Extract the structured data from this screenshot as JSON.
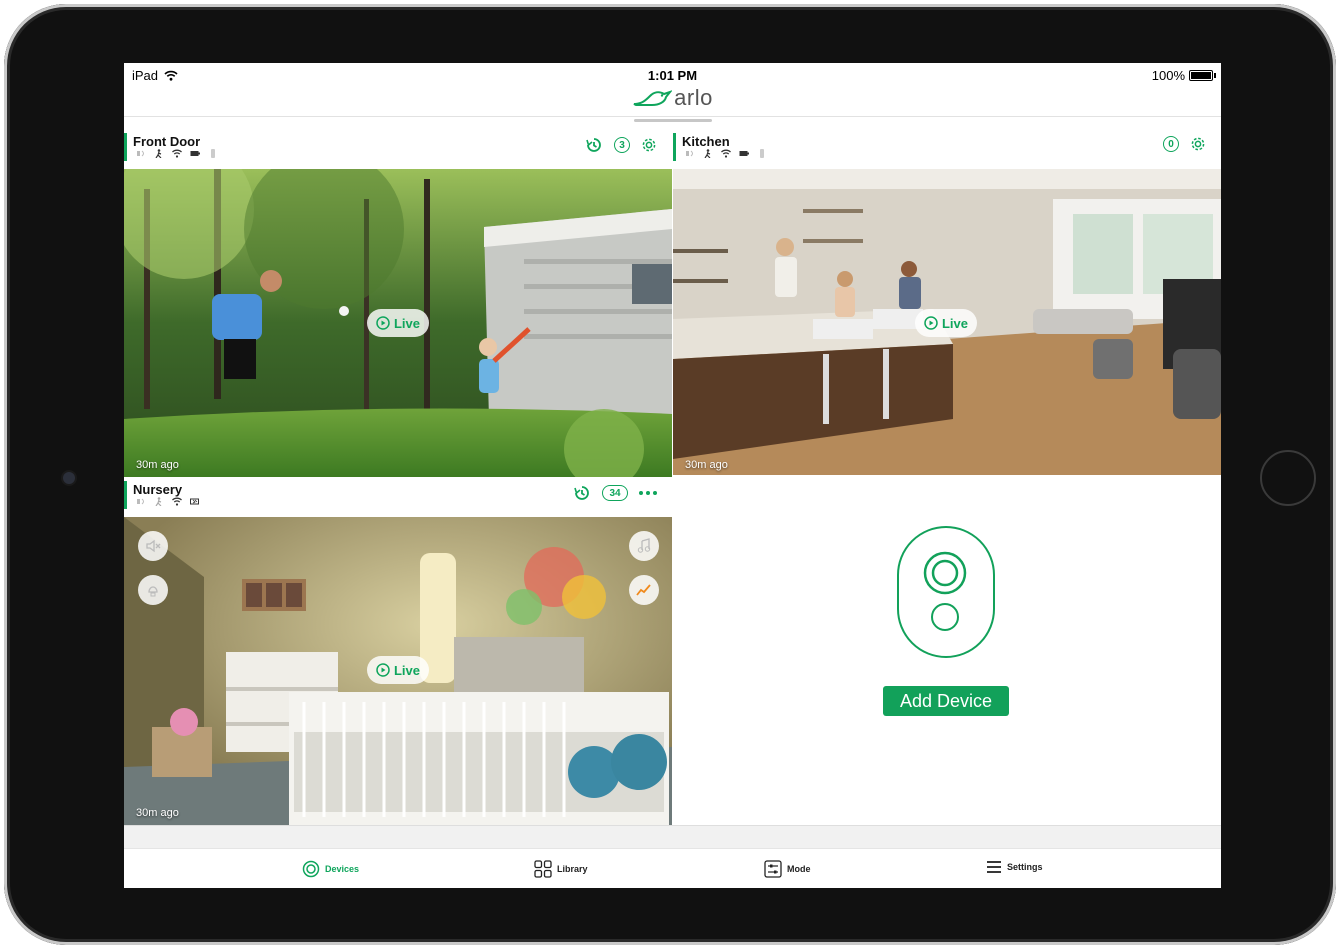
{
  "status_bar": {
    "device": "iPad",
    "time": "1:01 PM",
    "battery": "100%"
  },
  "app": {
    "logo_text": "arlo",
    "brand_color": "#0fa55c"
  },
  "cameras": [
    {
      "name": "Front Door",
      "clip_count": "3",
      "last_seen": "30m ago",
      "live_label": "Live"
    },
    {
      "name": "Kitchen",
      "clip_count": "0",
      "last_seen": "30m ago",
      "live_label": "Live"
    },
    {
      "name": "Nursery",
      "clip_count": "34",
      "last_seen": "30m ago",
      "live_label": "Live"
    }
  ],
  "add_device": {
    "label": "Add Device"
  },
  "tabs": [
    {
      "label": "Devices",
      "icon": "devices-icon",
      "active": true
    },
    {
      "label": "Library",
      "icon": "library-grid-icon",
      "active": false
    },
    {
      "label": "Mode",
      "icon": "mode-sliders-icon",
      "active": false
    },
    {
      "label": "Settings",
      "icon": "settings-menu-icon",
      "active": false
    }
  ]
}
